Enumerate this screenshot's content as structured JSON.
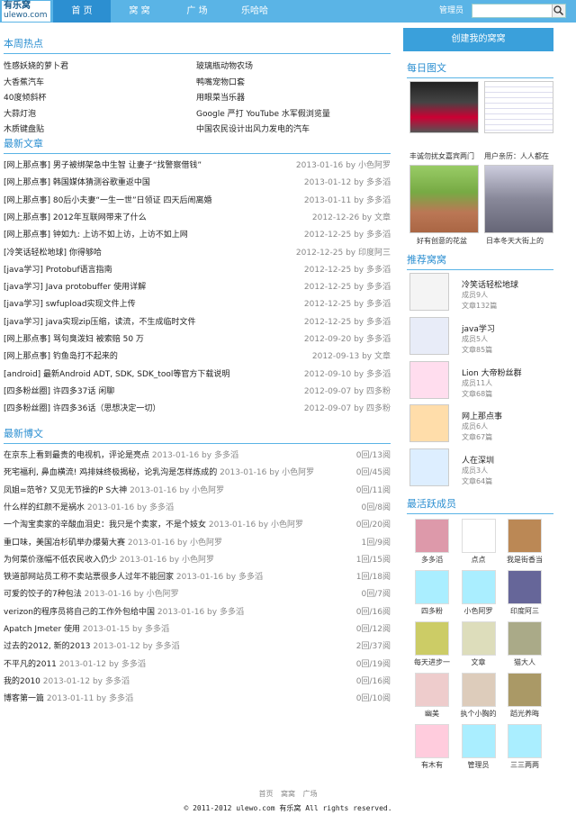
{
  "header": {
    "logo_line1": "有乐窝",
    "logo_line2": "ulewo.com",
    "nav": [
      "首 页",
      "窝 窝",
      "广 场",
      "乐哈哈"
    ],
    "user": "管理员",
    "search_placeholder": ""
  },
  "hot": {
    "title": "本周热点",
    "items": [
      "性感妖娆的萝卜君",
      "玻璃瓶动物农场",
      "大香蕉汽车",
      "鸭嘴宠物口套",
      "40度倾斜杯",
      "用眼菜当乐器",
      "大蒜灯泡",
      "Google 严打 YouTube 水军假浏览量",
      "木质键盘贴",
      "中国农民设计出风力发电的汽车"
    ]
  },
  "articles": {
    "title": "最新文章",
    "items": [
      {
        "t": "[网上那点事] 男子被绑架急中生智 让妻子“找警察借钱”",
        "m": "2013-01-16 by 小色阿罗"
      },
      {
        "t": "[网上那点事] 韩国媒体猜测谷歌重返中国",
        "m": "2013-01-12 by 多多滔"
      },
      {
        "t": "[网上那点事] 80后小夫妻“一生一世”日领证 四天后闹离婚",
        "m": "2013-01-11 by 多多滔"
      },
      {
        "t": "[网上那点事] 2012年互联网带来了什么",
        "m": "2012-12-26 by 文章"
      },
      {
        "t": "[网上那点事] 钟如九: 上访不如上访，上访不如上网",
        "m": "2012-12-25 by 多多滔"
      },
      {
        "t": "[冷笑话轻松地球] 你得够哈",
        "m": "2012-12-25 by 印度阿三"
      },
      {
        "t": "[java学习] Protobuf语言指南",
        "m": "2012-12-25 by 多多滔"
      },
      {
        "t": "[java学习] Java protobuffer 使用详解",
        "m": "2012-12-25 by 多多滔"
      },
      {
        "t": "[java学习] swfupload实现文件上传",
        "m": "2012-12-25 by 多多滔"
      },
      {
        "t": "[java学习] java实现zip压缩，读流，不生成临时文件",
        "m": "2012-12-25 by 多多滔"
      },
      {
        "t": "[网上那点事] 骂句臭泼妇 被索赔 50 万",
        "m": "2012-09-20 by 多多滔"
      },
      {
        "t": "[网上那点事] 钓鱼岛打不起来的",
        "m": "2012-09-13 by 文章"
      },
      {
        "t": "[android] 最新Android ADT, SDK, SDK_tool等官方下载说明",
        "m": "2012-09-10 by 多多滔"
      },
      {
        "t": "[四多粉丝圈] 许四多37话 闲聊",
        "m": "2012-09-07 by 四多粉"
      },
      {
        "t": "[四多粉丝圈] 许四多36话（思想决定一切）",
        "m": "2012-09-07 by 四多粉"
      }
    ]
  },
  "blogs": {
    "title": "最新博文",
    "items": [
      {
        "t": "在京东上看到最贵的电视机，评论是亮点",
        "m": "2013-01-16 by 多多滔",
        "c": "0回/13阅"
      },
      {
        "t": "死宅福利, 鼻血横流! 鸡排妹终极揭秘，论乳沟是怎样炼成的",
        "m": "2013-01-16 by 小色阿罗",
        "c": "0回/45阅"
      },
      {
        "t": "凤姐=范爷? 又见无节操的P S大神",
        "m": "2013-01-16 by 小色阿罗",
        "c": "0回/11阅"
      },
      {
        "t": "什么样的红颜不是祸水",
        "m": "2013-01-16 by 多多滔",
        "c": "0回/8阅"
      },
      {
        "t": "一个淘宝卖家的辛酸血泪史：我只是个卖家，不是个妓女",
        "m": "2013-01-16 by 小色阿罗",
        "c": "0回/20阅"
      },
      {
        "t": "重口味，美国冶杉矶举办爆菊大赛",
        "m": "2013-01-16 by 小色阿罗",
        "c": "1回/9阅"
      },
      {
        "t": "为何菜价涨幅不低农民收入仍少",
        "m": "2013-01-16 by 小色阿罗",
        "c": "1回/15阅"
      },
      {
        "t": "铁道部网站员工称不卖站票很多人过年不能回家",
        "m": "2013-01-16 by 多多滔",
        "c": "1回/18阅"
      },
      {
        "t": "可爱的饺子的7种包法",
        "m": "2013-01-16 by 小色阿罗",
        "c": "0回/7阅"
      },
      {
        "t": "verizon的程序员将自己的工作外包给中国",
        "m": "2013-01-16 by 多多滔",
        "c": "0回/16阅"
      },
      {
        "t": "Apatch Jmeter 使用",
        "m": "2013-01-15 by 多多滔",
        "c": "0回/12阅"
      },
      {
        "t": "过去的2012, 新的2013",
        "m": "2013-01-12 by 多多滔",
        "c": "2回/37阅"
      },
      {
        "t": "不平凡的2011",
        "m": "2013-01-12 by 多多滔",
        "c": "0回/19阅"
      },
      {
        "t": "我的2010",
        "m": "2013-01-12 by 多多滔",
        "c": "0回/16阅"
      },
      {
        "t": "博客第一篇",
        "m": "2013-01-11 by 多多滔",
        "c": "0回/10阅"
      }
    ]
  },
  "sidebar": {
    "create": "创建我的窝窝",
    "daily_title": "每日图文",
    "daily": [
      "丰诚勿扰女嘉宾两门",
      "用户亲历：人人都在",
      "好有创意的花盆",
      "日本冬天大街上的"
    ],
    "wowo_title": "推荐窝窝",
    "wowo": [
      {
        "name": "冷笑话轻松地球",
        "members": "成员9人",
        "posts": "文章132篇"
      },
      {
        "name": "java学习",
        "members": "成员5人",
        "posts": "文章85篇"
      },
      {
        "name": "Lion 大帝粉丝群",
        "members": "成员11人",
        "posts": "文章68篇"
      },
      {
        "name": "网上那点事",
        "members": "成员6人",
        "posts": "文章67篇"
      },
      {
        "name": "人在深圳",
        "members": "成员3人",
        "posts": "文章64篇"
      }
    ],
    "members_title": "最活跃成员",
    "members": [
      "多多滔",
      "点点",
      "我是街香当",
      "四多粉",
      "小色阿罗",
      "印度阿三",
      "每天进步一",
      "文章",
      "猫大人",
      "幽美",
      "执个小胸的",
      "蹈光养晦",
      "有木有",
      "管理员",
      "三三两两"
    ]
  },
  "footer": {
    "links": [
      "首页",
      "窝窝",
      "广场"
    ],
    "copyright": "© 2011-2012  ulewo.com 有乐窝 All rights reserved."
  }
}
